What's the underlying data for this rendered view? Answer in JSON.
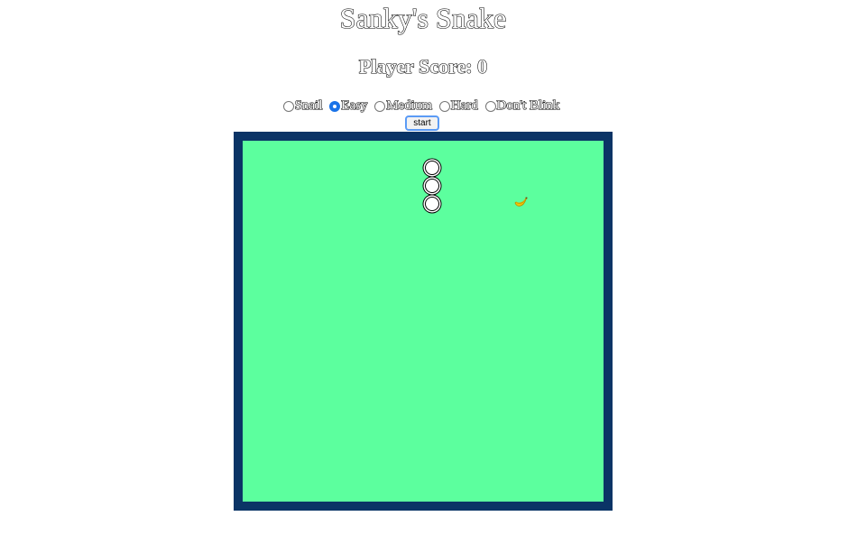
{
  "title": "Sanky's Snake",
  "score": {
    "text": "Player Score: 0",
    "label": "Player Score:",
    "value": 0
  },
  "difficulty": {
    "options": [
      "Snail",
      "Easy",
      "Medium",
      "Hard",
      "Don't Blink"
    ],
    "selected": "Easy"
  },
  "start_label": "start",
  "board": {
    "border_color": "#0b3466",
    "field_color": "#5cff9e"
  },
  "snake": {
    "length": 3,
    "segment_color": "#ffffff"
  },
  "food": {
    "icon": "banana-icon"
  }
}
